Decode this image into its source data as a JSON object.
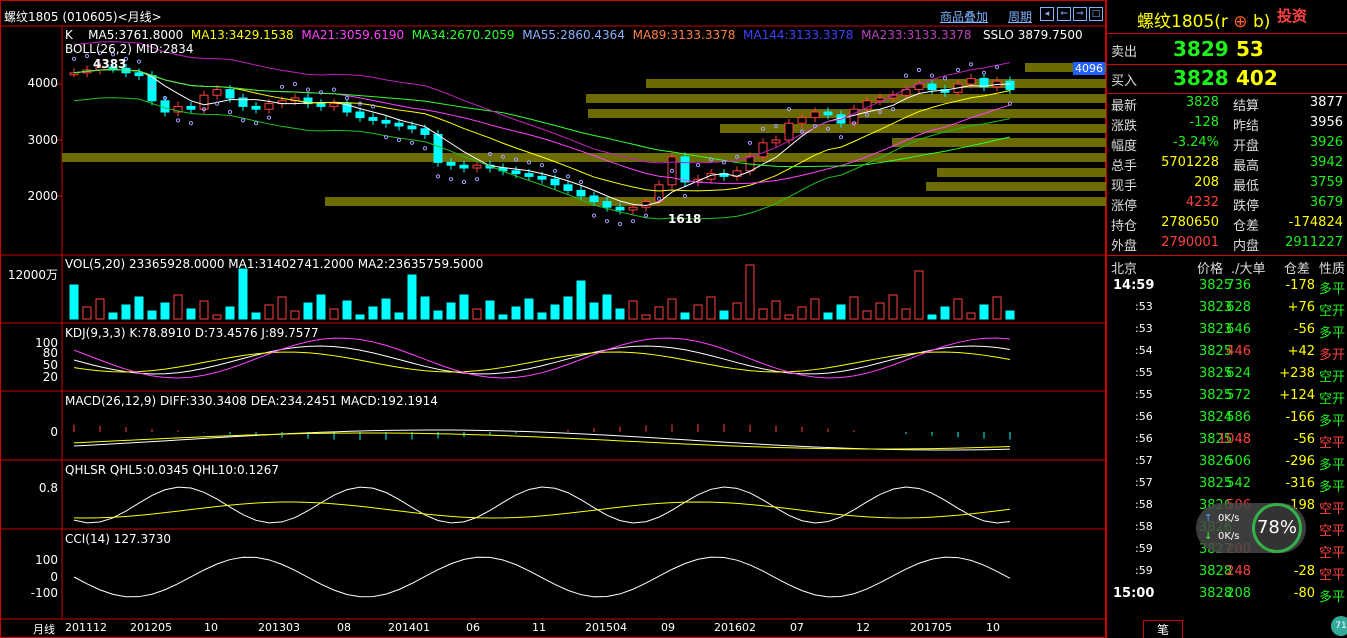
{
  "titlebar": {
    "symbol": "螺纹1805 (010605)<月线>",
    "menu_overlay": "商品叠加",
    "menu_period": "周期"
  },
  "panels": {
    "main": {
      "label": "K",
      "ma5": "MA5:3761.8000",
      "ma13": "MA13:3429.1538",
      "ma21": "MA21:3059.6190",
      "ma34": "MA34:2670.2059",
      "ma55": "MA55:2860.4364",
      "ma89": "MA89:3133.3378",
      "ma144": "MA144:3133.3378",
      "ma233": "MA233:3133.3378",
      "sslo": "SSLO  3879.7500",
      "boll": "BOLL(26,2)  MID:2834",
      "high_mark": "4383",
      "low_mark": "1618",
      "price_tag": "4096",
      "yticks": [
        "4000",
        "3000",
        "2000"
      ]
    },
    "vol": {
      "label": "VOL(5,20)  23365928.0000  MA1:31402741.2000  MA2:23635759.5000",
      "ytick": "12000万"
    },
    "kdj": {
      "label": "KDJ(9,3,3)  K:78.8910  D:73.4576  J:89.7577",
      "yticks": [
        "100",
        "80",
        "50",
        "20"
      ]
    },
    "macd": {
      "label": "MACD(26,12,9)  DIFF:330.3408  DEA:234.2451  MACD:192.1914",
      "ytick": "0"
    },
    "qhlsr": {
      "label": "QHLSR  QHL5:0.0345  QHL10:0.1267",
      "ytick": "0.8"
    },
    "cci": {
      "label": "CCI(14)  127.3730",
      "yticks": [
        "100",
        "0",
        "-100"
      ]
    }
  },
  "xaxis": {
    "period": "月线",
    "ticks": [
      "201112",
      "201205",
      "10",
      "201303",
      "08",
      "201401",
      "06",
      "11",
      "201504",
      "09",
      "201602",
      "07",
      "12",
      "201705",
      "10"
    ]
  },
  "quote": {
    "name": "螺纹1805(r",
    "name_tail": "b)",
    "brand": "投资",
    "sell_label": "卖出",
    "sell_price": "3829",
    "sell_vol": "53",
    "buy_label": "买入",
    "buy_price": "3828",
    "buy_vol": "402",
    "stats": [
      {
        "l1": "最新",
        "v1": "3828",
        "c1": "grn",
        "l2": "结算",
        "v2": "3877",
        "c2": "wht"
      },
      {
        "l1": "涨跌",
        "v1": "-128",
        "c1": "grn",
        "l2": "昨结",
        "v2": "3956",
        "c2": "wht"
      },
      {
        "l1": "幅度",
        "v1": "-3.24%",
        "c1": "grn",
        "l2": "开盘",
        "v2": "3926",
        "c2": "grn"
      },
      {
        "l1": "总手",
        "v1": "5701228",
        "c1": "yel",
        "l2": "最高",
        "v2": "3942",
        "c2": "grn"
      },
      {
        "l1": "现手",
        "v1": "208",
        "c1": "yel",
        "l2": "最低",
        "v2": "3759",
        "c2": "grn"
      },
      {
        "l1": "涨停",
        "v1": "4232",
        "c1": "red",
        "l2": "跌停",
        "v2": "3679",
        "c2": "grn"
      },
      {
        "l1": "持仓",
        "v1": "2780650",
        "c1": "yel",
        "l2": "仓差",
        "v2": "-174824",
        "c2": "yel"
      },
      {
        "l1": "外盘",
        "v1": "2790001",
        "c1": "red",
        "l2": "内盘",
        "v2": "2911227",
        "c2": "grn"
      }
    ],
    "tick_header": {
      "time": "北京",
      "price": "价格",
      "vol": "./大单",
      "oi": "仓差",
      "nature": "性质"
    },
    "ticks": [
      {
        "t": "14:59",
        "p": "3825",
        "v": "736",
        "vc": "grn",
        "o": "-178",
        "oc": "yel",
        "n": "多平",
        "nc": "grn"
      },
      {
        "t": ":53",
        "p": "3823",
        "v": "628",
        "vc": "grn",
        "o": "+76",
        "oc": "yel",
        "n": "空开",
        "nc": "grn"
      },
      {
        "t": ":53",
        "p": "3823",
        "v": "646",
        "vc": "grn",
        "o": "-56",
        "oc": "yel",
        "n": "多平",
        "nc": "grn"
      },
      {
        "t": ":54",
        "p": "3825",
        "v": "446",
        "vc": "red",
        "o": "+42",
        "oc": "yel",
        "n": "多开",
        "nc": "red"
      },
      {
        "t": ":55",
        "p": "3825",
        "v": "624",
        "vc": "grn",
        "o": "+238",
        "oc": "yel",
        "n": "空开",
        "nc": "grn"
      },
      {
        "t": ":55",
        "p": "3825",
        "v": "572",
        "vc": "grn",
        "o": "+124",
        "oc": "yel",
        "n": "空开",
        "nc": "grn"
      },
      {
        "t": ":56",
        "p": "3824",
        "v": "586",
        "vc": "grn",
        "o": "-166",
        "oc": "yel",
        "n": "多平",
        "nc": "grn"
      },
      {
        "t": ":56",
        "p": "3825",
        "v": "1048",
        "vc": "red",
        "o": "-56",
        "oc": "yel",
        "n": "空平",
        "nc": "red"
      },
      {
        "t": ":57",
        "p": "3826",
        "v": "506",
        "vc": "grn",
        "o": "-296",
        "oc": "yel",
        "n": "多平",
        "nc": "grn"
      },
      {
        "t": ":57",
        "p": "3825",
        "v": "542",
        "vc": "grn",
        "o": "-316",
        "oc": "yel",
        "n": "多平",
        "nc": "grn"
      },
      {
        "t": ":58",
        "p": "3826",
        "v": "506",
        "vc": "red",
        "o": "-198",
        "oc": "yel",
        "n": "空平",
        "nc": "red"
      },
      {
        "t": ":58",
        "p": "3826",
        "v": "",
        "vc": "red",
        "o": "",
        "oc": "yel",
        "n": "空平",
        "nc": "red"
      },
      {
        "t": ":59",
        "p": "3827",
        "v": "200",
        "vc": "red",
        "o": "",
        "oc": "yel",
        "n": "空平",
        "nc": "red"
      },
      {
        "t": ":59",
        "p": "3828",
        "v": "248",
        "vc": "red",
        "o": "-28",
        "oc": "yel",
        "n": "空平",
        "nc": "red"
      },
      {
        "t": "15:00",
        "p": "3828",
        "v": "208",
        "vc": "grn",
        "o": "-80",
        "oc": "yel",
        "n": "多平",
        "nc": "grn"
      }
    ],
    "bottom_tab": "笔"
  },
  "net_widget": {
    "up": "0K/s",
    "down": "0K/s",
    "percent": "78%"
  }
}
